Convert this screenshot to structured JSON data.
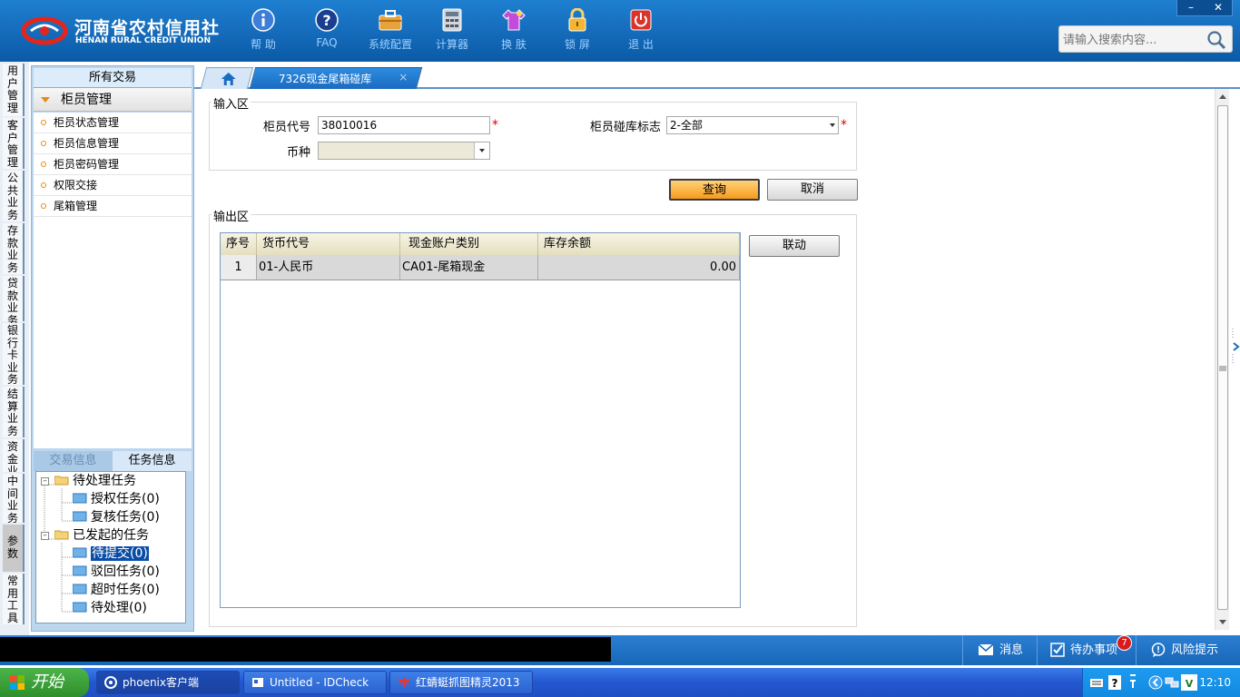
{
  "header": {
    "logo_cn": "河南省农村信用社",
    "logo_en": "HENAN RURAL CREDIT UNION",
    "tools": [
      {
        "label": "帮 助",
        "icon": "info-icon"
      },
      {
        "label": "FAQ",
        "icon": "question-icon"
      },
      {
        "label": "系统配置",
        "icon": "toolbox-icon"
      },
      {
        "label": "计算器",
        "icon": "calculator-icon"
      },
      {
        "label": "换 肤",
        "icon": "shirt-icon"
      },
      {
        "label": "锁 屏",
        "icon": "lock-icon"
      },
      {
        "label": "退 出",
        "icon": "power-icon"
      }
    ],
    "search_placeholder": "请输入搜索内容...",
    "win_min": "–",
    "win_close": "✕"
  },
  "vnav": [
    {
      "label": "用户管理"
    },
    {
      "label": "客户管理"
    },
    {
      "label": "公共业务"
    },
    {
      "label": "存款业务"
    },
    {
      "label": "贷款业务"
    },
    {
      "label": "银行卡业务"
    },
    {
      "label": "结算业务"
    },
    {
      "label": "资金业务"
    },
    {
      "label": "中间业务"
    },
    {
      "label": "参数"
    },
    {
      "label": "常用工具"
    }
  ],
  "left_panel": {
    "title": "所有交易",
    "group": "柜员管理",
    "items": [
      "柜员状态管理",
      "柜员信息管理",
      "柜员密码管理",
      "权限交接",
      "尾箱管理"
    ],
    "tab_trade": "交易信息",
    "tab_task": "任务信息",
    "tree": {
      "pending": "待处理任务",
      "auth": "授权任务(0)",
      "review": "复核任务(0)",
      "initiated": "已发起的任务",
      "to_submit": "待提交(0)",
      "rejected": "驳回任务(0)",
      "timeout": "超时任务(0)",
      "to_process": "待处理(0)"
    }
  },
  "tabs": {
    "active": "7326现金尾箱碰库",
    "close": "×"
  },
  "form": {
    "input_legend": "输入区",
    "teller_code_label": "柜员代号",
    "teller_code_value": "38010016",
    "flag_label": "柜员碰库标志",
    "flag_value": "2-全部",
    "currency_label": "币种",
    "currency_value": "",
    "required": "*",
    "query_button": "查询",
    "cancel_button": "取消",
    "output_legend": "输出区",
    "link_button": "联动"
  },
  "grid": {
    "headers": [
      "序号",
      "货币代号",
      "现金账户类别",
      "库存余额"
    ],
    "rows": [
      {
        "no": "1",
        "currency": "01-人民币",
        "account_type": "CA01-尾箱现金",
        "balance": "0.00"
      }
    ]
  },
  "statusbar": {
    "messages": "消息",
    "todo": "待办事项",
    "todo_count": "7",
    "risk": "风险提示"
  },
  "taskbar": {
    "start": "开始",
    "tasks": [
      "phoenix客户端",
      "Untitled - IDCheck",
      "红蜻蜓抓图精灵2013"
    ],
    "clock": "12:10"
  },
  "colors": {
    "header_blue": "#0b5aa6",
    "primary_button": "#f79a1e",
    "tab_active": "#1a6cc0"
  }
}
